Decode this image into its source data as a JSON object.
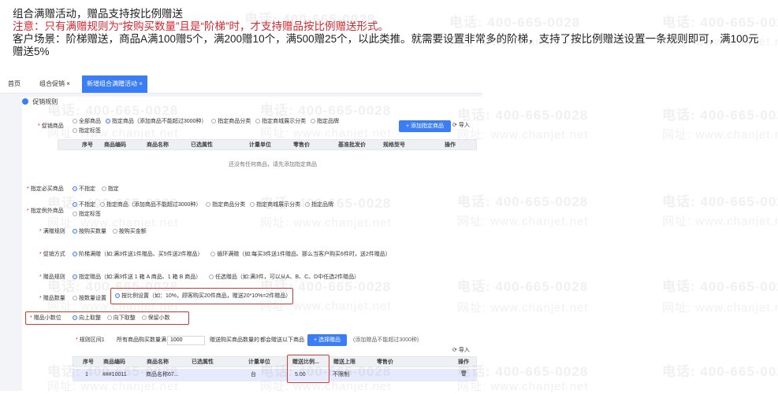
{
  "intro": {
    "line1": "组合满赠活动，赠品支持按比例赠送",
    "line2": "注意：只有满赠规则为“按购买数量”且是“阶梯”时，才支持赠品按比例赠送形式。",
    "line3": "客户场景：阶梯赠送，商品A满100赠5个，满200赠10个，满500赠25个，以此类推。就需要设置非常多的阶梯，支持了按比例赠送设置一条规则即可，满100元赠送5%"
  },
  "tabs": [
    {
      "label": "首页"
    },
    {
      "label": "组合促销 ×"
    },
    {
      "label": "新增组合满赠活动 ×"
    }
  ],
  "section_title": "促销规则",
  "promo_goods": {
    "label": "促销商品",
    "options": [
      "全部商品",
      "指定商品（添加商品不能超过3000种）",
      "指定商品分类",
      "指定商城展示分类",
      "指定品牌",
      "指定标签"
    ],
    "selected": 1,
    "add_button": "+ 添加指定商品",
    "import": "导入"
  },
  "goods_table": {
    "headers": [
      "序号",
      "商品编码",
      "商品名称",
      "已选属性",
      "计量单位",
      "零售价",
      "基准批发价",
      "规格型号",
      "操作"
    ],
    "empty": "还没有任何商品，请先添加指定商品"
  },
  "must_buy": {
    "label": "指定必买商品",
    "options": [
      "不指定",
      "指定"
    ],
    "selected": 0
  },
  "exclude": {
    "label": "指定例外商品",
    "options": [
      "不指定",
      "指定商品（添加商品不能超过3000种）",
      "指定商品分类",
      "指定商城展示分类",
      "指定品牌",
      "指定标签"
    ],
    "selected": 0
  },
  "gift_rule": {
    "label": "满赠规则",
    "options": [
      "按购买数量",
      "按购买金额"
    ],
    "selected": 0
  },
  "promo_method": {
    "label": "促销方式",
    "options": [
      "阶梯满赠（如:满3件送1件赠品、买5件送2件赠品）",
      "循环满赠（如:每买3件送1件赠品、那么当客户购买6件时，送2件赠品）"
    ],
    "selected": 0
  },
  "gift_scope": {
    "label": "赠品规则",
    "options": [
      "指定赠品（如:满3件送 1 箱 A 商品、1 箱 B 商品）",
      "任选赠品（如:满3件，可以从A、B、C、D中任选2件赠品）"
    ],
    "selected": 0
  },
  "gift_qty": {
    "label": "赠品数量",
    "options": [
      "按数量设置",
      "按比例设置（如：10%，顾客购买20件商品，赠送20*10%=2件赠品）"
    ],
    "selected": 1
  },
  "gift_decimal": {
    "label": "赠品小数位",
    "options": [
      "向上取整",
      "向下取整",
      "保留小数"
    ],
    "selected": 0
  },
  "rule_range": {
    "label": "规则区间1",
    "text1": "所有商品购买数量满",
    "value": "1000",
    "text2": "赠送购买商品数量的",
    "text3": "都会赠送以下商品",
    "select_button": "+ 选择赠品",
    "limit": "(添加赠品不能超过3000种)",
    "import": "导入"
  },
  "gift_table": {
    "headers": [
      "序号",
      "商品编码",
      "商品名称",
      "已选属性",
      "计量单位",
      "赠送比例...",
      "赠送上限",
      "零售价",
      "操作"
    ],
    "rows": [
      {
        "no": "1",
        "code": "###10011",
        "name": "商品名称67...",
        "attr": "",
        "unit": "台",
        "ratio": "5.00",
        "cap": "不限制",
        "price": ""
      }
    ]
  },
  "watermarks": {
    "phone": "电话: 400-665-0028",
    "site": "网址: www.chanjet.net"
  },
  "colors": {
    "accent": "#3b7df5",
    "highlight": "#e0362b",
    "warning_text": "#d9272e"
  }
}
